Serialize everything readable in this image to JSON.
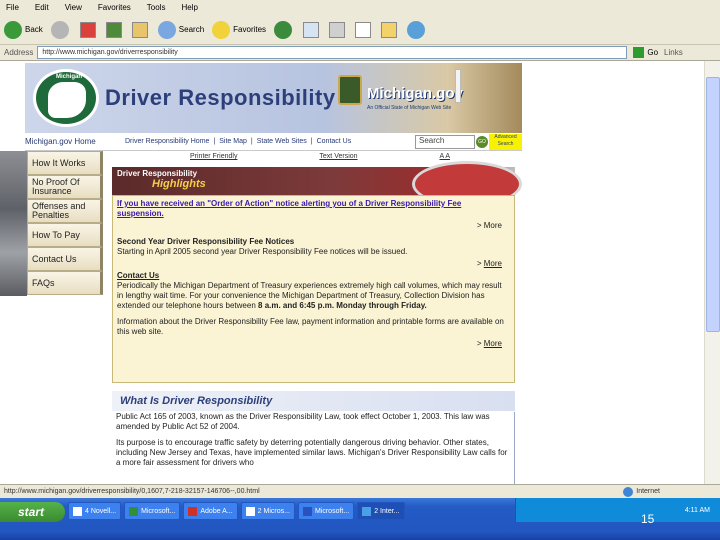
{
  "menu": [
    "File",
    "Edit",
    "View",
    "Favorites",
    "Tools",
    "Help"
  ],
  "toolbar": {
    "back": "Back",
    "search": "Search",
    "favorites": "Favorites"
  },
  "address": {
    "label": "Address",
    "url": "http://www.michigan.gov/driverresponsibility",
    "go": "Go",
    "links": "Links"
  },
  "banner": {
    "title": "Driver Responsibility",
    "logo_text": "Michigan",
    "mgov": "Michigan.gov",
    "mgov_sub": "An Official State of Michigan Web Site"
  },
  "nav": {
    "home": "Michigan.gov Home",
    "links": [
      "Driver Responsibility Home",
      "|",
      "Site Map",
      "|",
      "State Web Sites",
      "|",
      "Contact Us"
    ],
    "search_placeholder": "Search",
    "go": "GO",
    "advanced": "Advanced Search"
  },
  "sidebar": {
    "items": [
      {
        "label": "How It Works"
      },
      {
        "label": "No Proof Of Insurance"
      },
      {
        "label": "Offenses and Penalties"
      },
      {
        "label": "How To Pay"
      },
      {
        "label": "Contact Us"
      },
      {
        "label": "FAQs"
      }
    ]
  },
  "top_links": [
    "Printer Friendly",
    "Text Version",
    "A A"
  ],
  "highlights": {
    "header": "Driver Responsibility",
    "subheader": "Highlights",
    "item1_link": "If you have received an \"Order of Action\" notice alerting you of a Driver Responsibility Fee suspension.",
    "more": "More",
    "item2_title": "Second Year Driver Responsibility Fee Notices",
    "item2_text": "Starting in April 2005 second year Driver Responsibility Fee notices will be issued.",
    "item3_title": "Contact Us",
    "item3_text": "Periodically the Michigan Department of Treasury experiences extremely high call volumes, which may result in lengthy wait time. For your convenience the Michigan Department of Treasury, Collection Division has extended our telephone hours between",
    "item3_bold": "8 a.m. and 6:45 p.m. Monday through Friday.",
    "item4_text": "Information about the Driver Responsibility Fee law, payment information and printable forms are available on this web site."
  },
  "what_is": {
    "title": "What Is Driver Responsibility",
    "p1": "Public Act 165 of 2003, known as the Driver Responsibility Law, took effect October 1, 2003. This law was amended by Public Act 52 of 2004.",
    "p2": "Its purpose is to encourage traffic safety by deterring potentially dangerous driving behavior. Other states, including New Jersey and Texas, have implemented similar laws. Michigan's Driver Responsibility Law calls for a more fair assessment for drivers who"
  },
  "status": {
    "url": "http://www.michigan.gov/driverresponsibility/0,1607,7-218-32157-146706--,00.html",
    "zone": "Internet"
  },
  "taskbar": {
    "start": "start",
    "tasks": [
      "4 Novell...",
      "Microsoft...",
      "Adobe A...",
      "2 Micros...",
      "Microsoft...",
      "2 Inter..."
    ],
    "time": "4:11 AM"
  },
  "page_number": "15"
}
